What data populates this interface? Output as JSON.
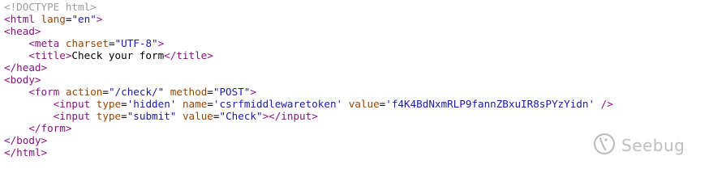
{
  "source_lines": [
    {
      "tokens": [
        {
          "t": "doctype",
          "v": "<!DOCTYPE html>"
        }
      ]
    },
    {
      "tokens": [
        {
          "t": "tag",
          "v": "<html"
        },
        {
          "t": "text",
          "v": " "
        },
        {
          "t": "attr",
          "v": "lang"
        },
        {
          "t": "text",
          "v": "="
        },
        {
          "t": "val",
          "v": "\"en\""
        },
        {
          "t": "tag",
          "v": ">"
        }
      ]
    },
    {
      "tokens": [
        {
          "t": "tag",
          "v": "<head>"
        }
      ]
    },
    {
      "tokens": [
        {
          "t": "text",
          "v": "    "
        },
        {
          "t": "tag",
          "v": "<meta"
        },
        {
          "t": "text",
          "v": " "
        },
        {
          "t": "attr",
          "v": "charset"
        },
        {
          "t": "text",
          "v": "="
        },
        {
          "t": "val",
          "v": "\"UTF-8\""
        },
        {
          "t": "tag",
          "v": ">"
        }
      ]
    },
    {
      "tokens": [
        {
          "t": "text",
          "v": "    "
        },
        {
          "t": "tag",
          "v": "<title>"
        },
        {
          "t": "text",
          "v": "Check your form"
        },
        {
          "t": "tag",
          "v": "</title>"
        }
      ]
    },
    {
      "tokens": [
        {
          "t": "tag",
          "v": "</head>"
        }
      ]
    },
    {
      "tokens": [
        {
          "t": "tag",
          "v": "<body>"
        }
      ]
    },
    {
      "tokens": [
        {
          "t": "text",
          "v": "    "
        },
        {
          "t": "tag",
          "v": "<form"
        },
        {
          "t": "text",
          "v": " "
        },
        {
          "t": "attr",
          "v": "action"
        },
        {
          "t": "text",
          "v": "="
        },
        {
          "t": "val",
          "v": "\"/check/\""
        },
        {
          "t": "text",
          "v": " "
        },
        {
          "t": "attr",
          "v": "method"
        },
        {
          "t": "text",
          "v": "="
        },
        {
          "t": "val",
          "v": "\"POST\""
        },
        {
          "t": "tag",
          "v": ">"
        }
      ]
    },
    {
      "tokens": [
        {
          "t": "text",
          "v": "        "
        },
        {
          "t": "tag",
          "v": "<input"
        },
        {
          "t": "text",
          "v": " "
        },
        {
          "t": "attr",
          "v": "type"
        },
        {
          "t": "text",
          "v": "="
        },
        {
          "t": "val",
          "v": "'hidden'"
        },
        {
          "t": "text",
          "v": " "
        },
        {
          "t": "attr",
          "v": "name"
        },
        {
          "t": "text",
          "v": "="
        },
        {
          "t": "val",
          "v": "'csrfmiddlewaretoken'"
        },
        {
          "t": "text",
          "v": " "
        },
        {
          "t": "attr",
          "v": "value"
        },
        {
          "t": "text",
          "v": "="
        },
        {
          "t": "val",
          "v": "'f4K4BdNxmRLP9fannZBxuIR8sPYzYidn'"
        },
        {
          "t": "text",
          "v": " "
        },
        {
          "t": "tag",
          "v": "/>"
        }
      ]
    },
    {
      "tokens": [
        {
          "t": "text",
          "v": "        "
        },
        {
          "t": "tag",
          "v": "<input"
        },
        {
          "t": "text",
          "v": " "
        },
        {
          "t": "attr",
          "v": "type"
        },
        {
          "t": "text",
          "v": "="
        },
        {
          "t": "val",
          "v": "\"submit\""
        },
        {
          "t": "text",
          "v": " "
        },
        {
          "t": "attr",
          "v": "value"
        },
        {
          "t": "text",
          "v": "="
        },
        {
          "t": "val",
          "v": "\"Check\""
        },
        {
          "t": "tag",
          "v": "></input>"
        }
      ]
    },
    {
      "tokens": [
        {
          "t": "text",
          "v": "    "
        },
        {
          "t": "tag",
          "v": "</form>"
        }
      ]
    },
    {
      "tokens": [
        {
          "t": "tag",
          "v": "</body>"
        }
      ]
    },
    {
      "tokens": [
        {
          "t": "tag",
          "v": "</html>"
        }
      ]
    }
  ],
  "watermark": {
    "brand": "Seebug",
    "icon": "seebug-logo-icon"
  },
  "colors": {
    "doctype": "#9a9a9a",
    "tag": "#881280",
    "attribute": "#994500",
    "value": "#1a1aa6",
    "text": "#000000",
    "background": "#ffffff"
  }
}
